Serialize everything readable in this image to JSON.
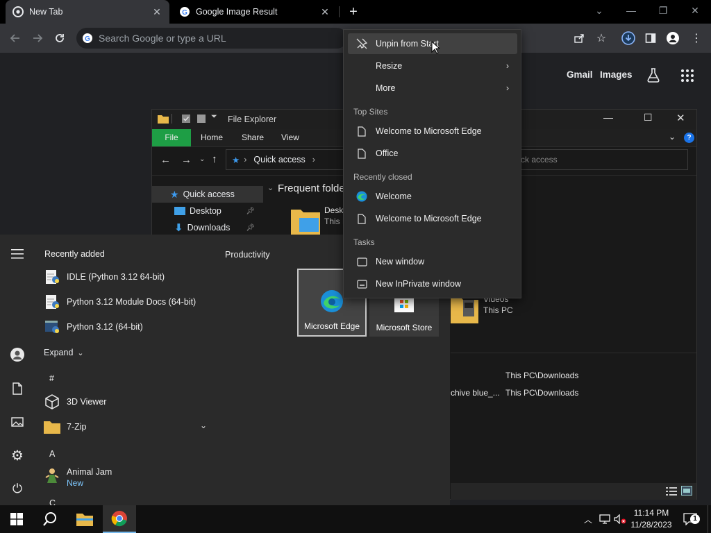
{
  "chrome": {
    "tabs": [
      {
        "title": "New Tab",
        "active": true
      },
      {
        "title": "Google Image Result",
        "active": false
      }
    ],
    "omnibox_placeholder": "Search Google or type a URL",
    "ntp_links": {
      "gmail": "Gmail",
      "images": "Images"
    }
  },
  "explorer": {
    "title": "File Explorer",
    "ribbon_tabs": [
      "File",
      "Home",
      "Share",
      "View"
    ],
    "address": "Quick access",
    "search_placeholder": "ck access",
    "section_title": "Frequent folde",
    "nav": [
      {
        "label": "Quick access",
        "pinned": false
      },
      {
        "label": "Desktop",
        "pinned": true
      },
      {
        "label": "Downloads",
        "pinned": true
      }
    ],
    "desktop_item": {
      "name": "Deskt",
      "sub": "This P"
    },
    "videos_item": {
      "name": "Videos",
      "sub": "This PC"
    },
    "recent_rows": [
      {
        "name": "",
        "path": "This PC\\Downloads"
      },
      {
        "name": "chive blue_...",
        "path": "This PC\\Downloads"
      }
    ]
  },
  "start": {
    "recently_added_label": "Recently added",
    "recent": [
      {
        "name": "IDLE (Python 3.12 64-bit)"
      },
      {
        "name": "Python 3.12 Module Docs (64-bit)"
      },
      {
        "name": "Python 3.12 (64-bit)"
      }
    ],
    "expand_label": "Expand",
    "groups": [
      {
        "letter": "#",
        "apps": [
          {
            "name": "3D Viewer",
            "sub": ""
          },
          {
            "name": "7-Zip",
            "sub": ""
          }
        ]
      },
      {
        "letter": "A",
        "apps": [
          {
            "name": "Animal Jam",
            "sub": "New"
          }
        ]
      },
      {
        "letter": "C",
        "apps": []
      }
    ],
    "productivity_label": "Productivity",
    "tiles": [
      {
        "name": "Microsoft Edge",
        "selected": true
      },
      {
        "name": "Microsoft Store",
        "selected": false
      }
    ]
  },
  "jumplist": {
    "actions": [
      {
        "label": "Unpin from Start",
        "hover": true
      },
      {
        "label": "Resize",
        "submenu": true
      },
      {
        "label": "More",
        "submenu": true
      }
    ],
    "top_sites_label": "Top Sites",
    "top_sites": [
      "Welcome to Microsoft Edge",
      "Office"
    ],
    "recently_closed_label": "Recently closed",
    "recently_closed": [
      "Welcome",
      "Welcome to Microsoft Edge"
    ],
    "tasks_label": "Tasks",
    "tasks": [
      "New window",
      "New InPrivate window"
    ]
  },
  "taskbar": {
    "time": "11:14 PM",
    "date": "11/28/2023",
    "notification_count": "1"
  },
  "colors": {
    "accent": "#76b9ed",
    "explorer_file_tab": "#1e9e45",
    "edge_blue": "#1a8fd8"
  }
}
